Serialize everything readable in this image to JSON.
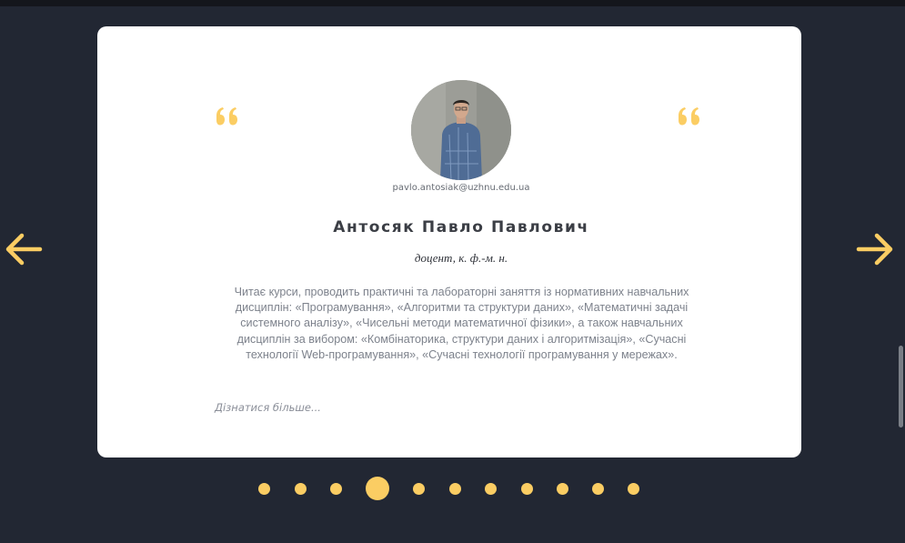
{
  "colors": {
    "background": "#222733",
    "card": "#ffffff",
    "accent": "#fbcd63",
    "name": "#3b3e45",
    "body_text": "#7d828c"
  },
  "icons": {
    "quote": "quote-icon",
    "prev": "arrow-left-icon",
    "next": "arrow-right-icon"
  },
  "profile": {
    "email": "pavlo.antosiak@uzhnu.edu.ua",
    "name": "Антосяк Павло Павлович",
    "position": "доцент, к. ф.-м. н.",
    "description": "Читає курси, проводить практичні та лабораторні заняття із нормативних навчальних дисциплін: «Програмування», «Алгоритми та структури даних», «Математичні задачі системного аналізу», «Чисельні методи математичної фізики», а також навчальних дисциплін за вибором: «Комбінаторика, структури даних і алгоритмізація», «Сучасні технології Web-програмування», «Сучасні технології програмування у мережах».",
    "more_link": "Дізнатися більше..."
  },
  "carousel": {
    "total_slides": 11,
    "active_index": 3
  }
}
